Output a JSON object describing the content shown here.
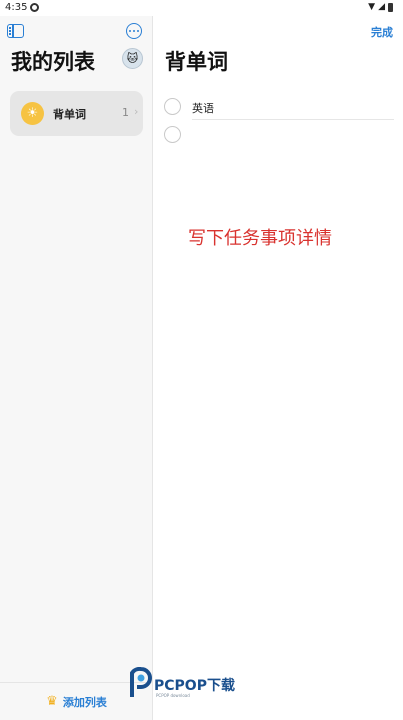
{
  "status_bar": {
    "time": "4:35"
  },
  "sidebar": {
    "title": "我的列表",
    "lists": [
      {
        "name": "背单词",
        "count": "1"
      }
    ],
    "footer": {
      "add_list_label": "添加列表"
    }
  },
  "detail": {
    "done_label": "完成",
    "title": "背单词",
    "tasks": [
      {
        "text": "英语"
      },
      {
        "text": ""
      }
    ]
  },
  "annotation": {
    "text": "写下任务事项详情"
  },
  "watermark": {
    "brand": "PCPOP下载",
    "sub": "PCPOP download"
  },
  "colors": {
    "accent": "#2a7fd4",
    "annotation": "#d9332f",
    "list_icon": "#f6c343"
  }
}
